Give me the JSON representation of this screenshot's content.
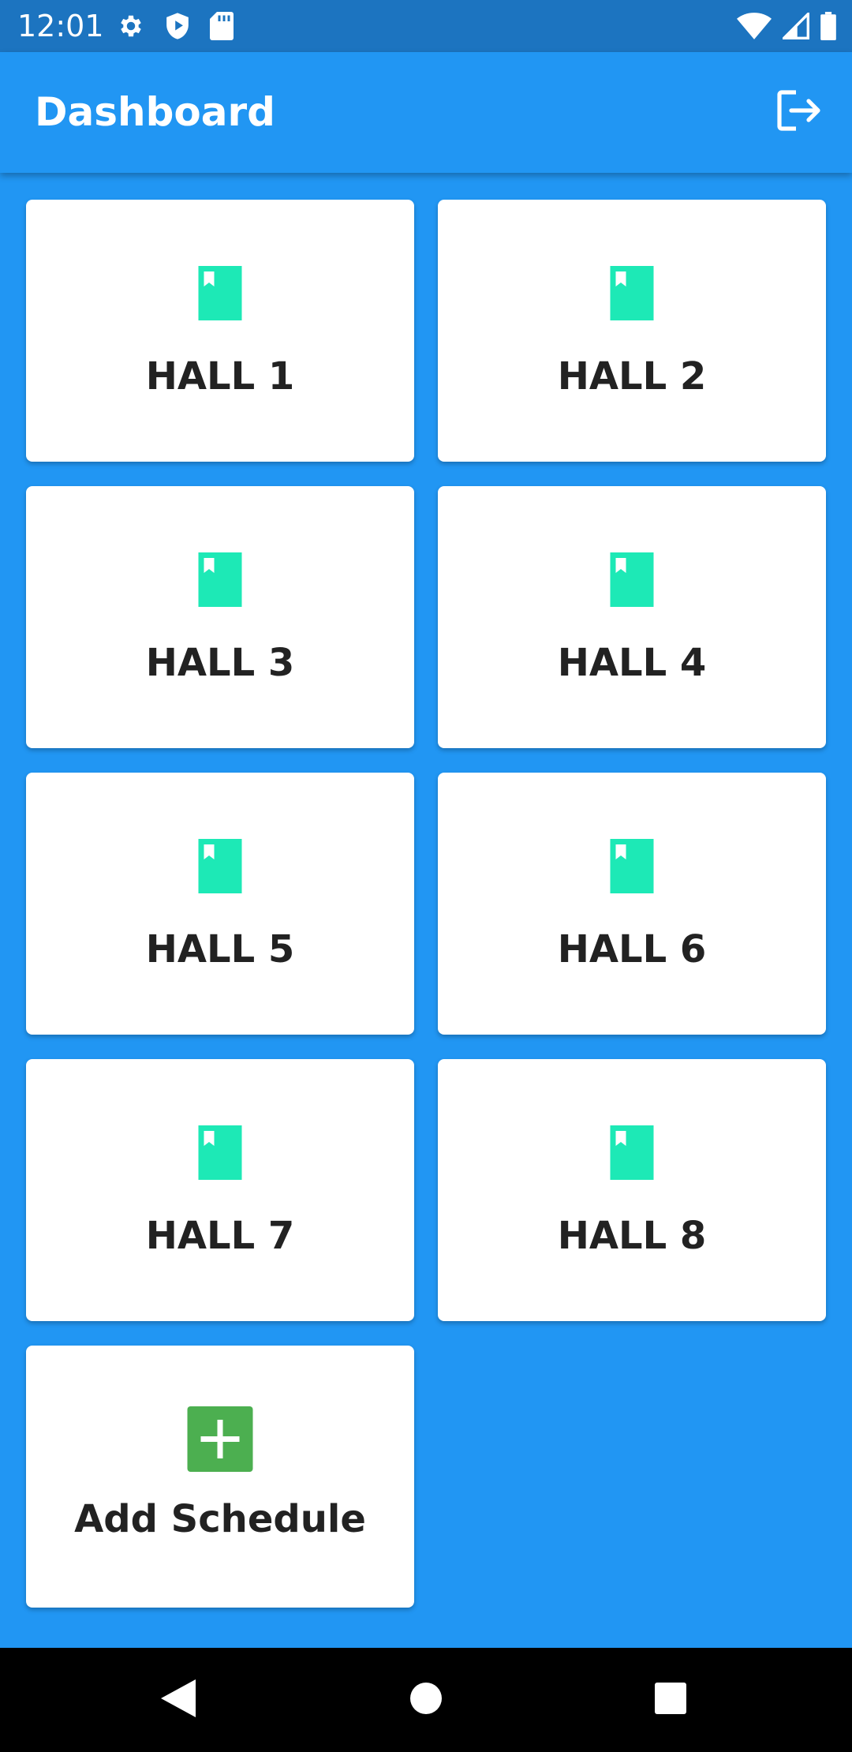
{
  "status_bar": {
    "time": "12:01",
    "left_icons": [
      "gear-icon",
      "shield-icon",
      "sd-card-icon"
    ],
    "right_icons": [
      "wifi-icon",
      "cell-signal-icon",
      "battery-icon"
    ]
  },
  "app_bar": {
    "title": "Dashboard",
    "action_icon": "logout-icon"
  },
  "halls": [
    {
      "label": "HALL 1",
      "icon": "book-icon"
    },
    {
      "label": "HALL 2",
      "icon": "book-icon"
    },
    {
      "label": "HALL 3",
      "icon": "book-icon"
    },
    {
      "label": "HALL 4",
      "icon": "book-icon"
    },
    {
      "label": "HALL 5",
      "icon": "book-icon"
    },
    {
      "label": "HALL 6",
      "icon": "book-icon"
    },
    {
      "label": "HALL 7",
      "icon": "book-icon"
    },
    {
      "label": "HALL 8",
      "icon": "book-icon"
    }
  ],
  "add_card": {
    "label": "Add Schedule",
    "icon": "plus-icon"
  },
  "nav_bar": {
    "buttons": [
      "back-icon",
      "home-icon",
      "recents-icon"
    ]
  },
  "colors": {
    "primary": "#2196f3",
    "status_bar": "#1c74c0",
    "hall_icon": "#1de9b6",
    "add_icon": "#4caf50",
    "card_text": "#222222"
  }
}
